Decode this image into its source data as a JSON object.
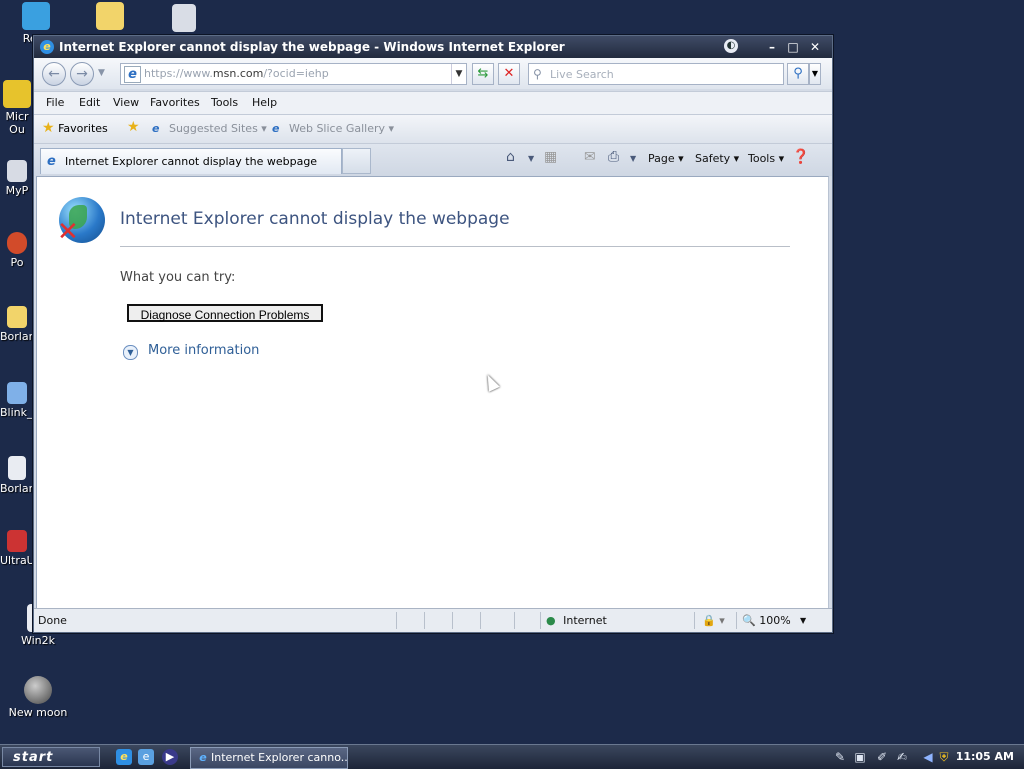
{
  "desktop": {
    "icons": [
      {
        "label": "Recy",
        "icon": "recycle-bin-icon",
        "color": "#3aa0e0"
      },
      {
        "label": "",
        "icon": "folder-icon",
        "color": "#f2d46a"
      },
      {
        "label": "",
        "icon": "video-file-icon",
        "color": "#d9dde6"
      },
      {
        "label": "Micr\nOu",
        "icon": "outlook-icon",
        "color": "#e7c32c"
      },
      {
        "label": "MyP",
        "icon": "shortcut-icon",
        "color": "#d7dbe4"
      },
      {
        "label": "Po",
        "icon": "shortcut-icon",
        "color": "#d24b2a"
      },
      {
        "label": "Borlan",
        "icon": "folder-icon",
        "color": "#f2d46a"
      },
      {
        "label": "Blink_I",
        "icon": "app-icon",
        "color": "#7fb0e8"
      },
      {
        "label": "Borlan",
        "icon": "document-icon",
        "color": "#e9ecf2"
      },
      {
        "label": "UltraU",
        "icon": "app-icon",
        "color": "#c33"
      },
      {
        "label": "Win2k",
        "icon": "shortcut-icon",
        "color": "#e9ecf2"
      },
      {
        "label": "New moon",
        "icon": "moon-icon",
        "color": "#888"
      }
    ]
  },
  "window": {
    "title": "Internet Explorer cannot display the webpage - Windows Internet Explorer",
    "address": {
      "prefix": "https://www.",
      "domain": "msn.com",
      "suffix": "/?ocid=iehp"
    },
    "search_placeholder": "Live Search",
    "menu": [
      "File",
      "Edit",
      "View",
      "Favorites",
      "Tools",
      "Help"
    ],
    "favorites_label": "Favorites",
    "suggested_sites": "Suggested Sites",
    "web_slice_gallery": "Web Slice Gallery",
    "tab_title": "Internet Explorer cannot display the webpage",
    "commands": {
      "page": "Page",
      "safety": "Safety",
      "tools": "Tools"
    }
  },
  "page": {
    "heading": "Internet Explorer cannot display the webpage",
    "what_you_can_try": "What you can try:",
    "diagnose_button": "Diagnose Connection Problems",
    "more_information": "More information"
  },
  "statusbar": {
    "status": "Done",
    "zone": "Internet",
    "zoom": "100%"
  },
  "taskbar": {
    "start": "start",
    "task_label": "Internet Explorer canno...",
    "clock": "11:05 AM"
  }
}
